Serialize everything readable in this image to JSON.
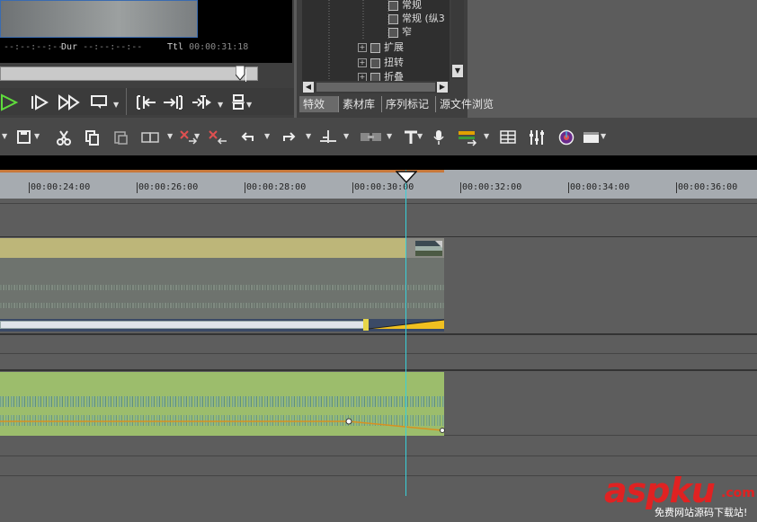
{
  "player": {
    "timecode_in": "--:--:--:--",
    "dur_label": "Dur",
    "dur_value": "--:--:--:--",
    "ttl_label": "Ttl",
    "ttl_value": "00:00:31:18",
    "controls": [
      {
        "name": "play-button",
        "glyph": "▷"
      },
      {
        "name": "step-forward-button",
        "glyph": "I▷"
      },
      {
        "name": "fast-forward-button",
        "glyph": "▷▷"
      },
      {
        "name": "loop-play-button",
        "glyph": "⌨"
      },
      {
        "name": "mark-in-button",
        "glyph": "]I←"
      },
      {
        "name": "mark-out-button",
        "glyph": "→]["
      },
      {
        "name": "split-button",
        "glyph": "▸I▸"
      },
      {
        "name": "insert-mode-button",
        "glyph": "⊟"
      }
    ]
  },
  "effects_tree": {
    "items": [
      {
        "label": "常规",
        "indent": 1,
        "expand": false
      },
      {
        "label": "常规 (纵3",
        "indent": 1,
        "expand": false
      },
      {
        "label": "窄",
        "indent": 1,
        "expand": false
      },
      {
        "label": "扩展",
        "indent": 0,
        "expand": true
      },
      {
        "label": "扭转",
        "indent": 0,
        "expand": true
      },
      {
        "label": "折叠",
        "indent": 0,
        "expand": true
      }
    ]
  },
  "panel_tabs": [
    "特效",
    "素材库",
    "序列标记",
    "源文件浏览"
  ],
  "toolbar": {
    "icons": [
      "save-icon",
      "cut-icon",
      "copy-icon",
      "paste-icon",
      "clip-icon",
      "delete-icon",
      "ripple-delete-icon",
      "undo-icon",
      "redo-icon",
      "split-icon",
      "link-icon",
      "title-icon",
      "mic-icon",
      "render-icon",
      "grid-icon",
      "mixer-icon",
      "color-icon",
      "output-icon"
    ]
  },
  "ruler": {
    "labels": [
      "00:00:24:00",
      "00:00:26:00",
      "00:00:28:00",
      "00:00:30:00",
      "00:00:32:00",
      "00:00:34:00",
      "00:00:36:00"
    ]
  },
  "watermark": {
    "logo": "aspku",
    "tld": ".com",
    "slogan": "免费网站源码下载站!"
  }
}
